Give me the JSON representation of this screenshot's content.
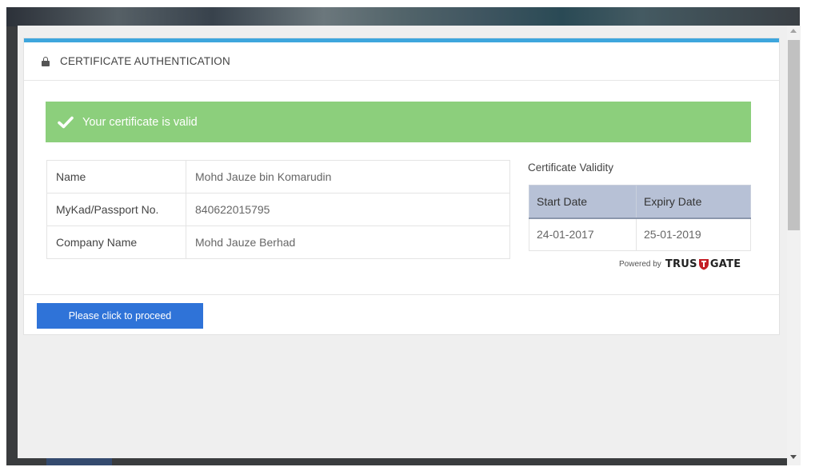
{
  "header": {
    "title": "CERTIFICATE AUTHENTICATION",
    "icon": "lock-icon"
  },
  "alert": {
    "message": "Your certificate is valid",
    "icon": "check-icon",
    "color": "#8ccf7c"
  },
  "details": [
    {
      "label": "Name",
      "value": "Mohd Jauze bin Komarudin"
    },
    {
      "label": "MyKad/Passport No.",
      "value": "840622015795"
    },
    {
      "label": "Company Name",
      "value": "Mohd Jauze Berhad"
    }
  ],
  "validity": {
    "title": "Certificate Validity",
    "headers": [
      "Start Date",
      "Expiry Date"
    ],
    "start_date": "24-01-2017",
    "expiry_date": "25-01-2019"
  },
  "powered_by": {
    "label": "Powered by",
    "brand_left": "TRUS",
    "brand_right": "GATE",
    "icon": "trustgate-shield-icon"
  },
  "footer": {
    "proceed_label": "Please click to proceed"
  },
  "colors": {
    "accent": "#3ea6dd",
    "button": "#2f73d8",
    "table_header": "#b7c1d6"
  }
}
